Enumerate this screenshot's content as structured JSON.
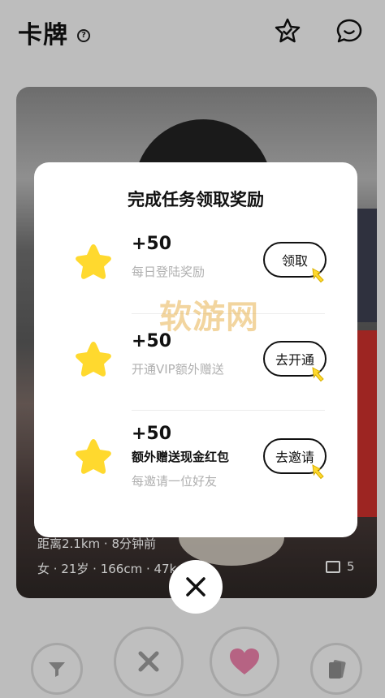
{
  "header": {
    "title": "卡牌",
    "help_icon": "question-circle-icon",
    "favorite_icon": "star-check-icon",
    "message_icon": "chat-smile-icon"
  },
  "card": {
    "distance": "距离2.1km · 8分钟前",
    "meta": "女 · 21岁 · 166cm · 47k",
    "photo_count": "5"
  },
  "modal": {
    "title": "完成任务领取奖励",
    "tasks": [
      {
        "points": "+50",
        "description": "每日登陆奖励",
        "button": "领取",
        "icon": "yellow-star-icon"
      },
      {
        "points": "+50",
        "description": "开通VIP额外赠送",
        "button": "去开通",
        "icon": "yellow-star-icon"
      },
      {
        "points": "+50",
        "subtitle": "额外赠送现金红包",
        "description": "每邀请一位好友",
        "button": "去邀请",
        "icon": "yellow-star-icon"
      }
    ],
    "star_color": "#FFD92E"
  },
  "watermark": "软游网",
  "bottom_bar": {
    "filter_icon": "filter-icon",
    "dislike_icon": "x-icon",
    "like_icon": "heart-icon",
    "cards_icon": "cards-icon"
  },
  "colors": {
    "accent": "#FFD92E",
    "heart": "#E97FA8"
  }
}
